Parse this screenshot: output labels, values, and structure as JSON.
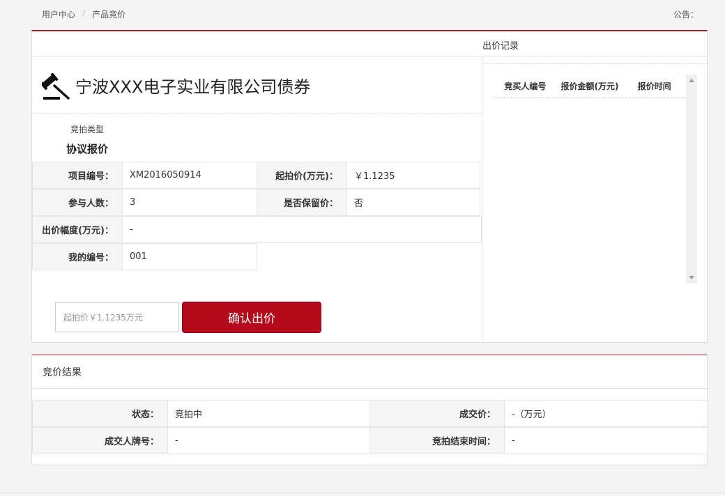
{
  "breadcrumb": {
    "home": "用户中心",
    "separator": "/",
    "current": "产品竞价"
  },
  "notice": {
    "label": "公告："
  },
  "bid_record": {
    "title": "出价记录",
    "columns": [
      "竞买人编号",
      "报价金额(万元)",
      "报价时间"
    ],
    "rows": []
  },
  "product": {
    "title": "宁波XXX电子实业有限公司债券",
    "icon": "gavel-icon",
    "type_label": "竞拍类型",
    "type_value": "协议报价"
  },
  "info": {
    "project_no_label": "项目编号：",
    "project_no": "XM2016050914",
    "start_price_label": "起拍价(万元)：",
    "start_price": "￥1.1235",
    "participants_label": "参与人数：",
    "participants": "3",
    "reserve_label": "是否保留价：",
    "reserve": "否",
    "increment_label": "出价幅度(万元)：",
    "increment": "-",
    "my_no_label": "我的编号：",
    "my_no": "001"
  },
  "bid_form": {
    "placeholder": "起拍价￥1.1235万元",
    "confirm_label": "确认出价"
  },
  "result": {
    "title": "竞价结果",
    "status_label": "状态：",
    "status": "竞拍中",
    "deal_price_label": "成交价：",
    "deal_price": "-（万元）",
    "winner_label": "成交人牌号：",
    "winner": "-",
    "end_time_label": "竞拍结束时间：",
    "end_time": "-"
  },
  "colors": {
    "accent": "#b5091c",
    "border_top": "#b5172b"
  }
}
